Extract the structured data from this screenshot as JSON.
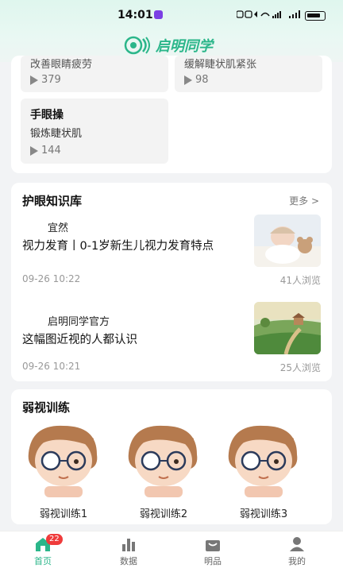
{
  "status": {
    "time": "14:01"
  },
  "brand": {
    "name": "启明同学",
    "color": "#2bb68a"
  },
  "top_tiles": [
    {
      "title": "",
      "subtitle": "改善眼睛疲劳",
      "plays": "379"
    },
    {
      "title": "",
      "subtitle": "缓解睫状肌紧张",
      "plays": "98"
    },
    {
      "title": "手眼操",
      "subtitle": "锻炼睫状肌",
      "plays": "144"
    }
  ],
  "knowledge": {
    "title": "护眼知识库",
    "more": "更多 >",
    "articles": [
      {
        "author": "宜然",
        "title": "视力发育丨0-1岁新生儿视力发育特点",
        "date": "09-26 10:22",
        "views": "41人浏览"
      },
      {
        "author": "启明同学官方",
        "title": "这幅图近视的人都认识",
        "date": "09-26 10:21",
        "views": "25人浏览"
      }
    ]
  },
  "training": {
    "title": "弱视训练",
    "items": [
      {
        "label": "弱视训练1"
      },
      {
        "label": "弱视训练2"
      },
      {
        "label": "弱视训练3"
      }
    ]
  },
  "tabbar": {
    "badge": "22",
    "items": [
      {
        "label": "首页",
        "icon": "home-icon",
        "active": true
      },
      {
        "label": "数据",
        "icon": "bar-chart-icon"
      },
      {
        "label": "明品",
        "icon": "bag-icon"
      },
      {
        "label": "我的",
        "icon": "user-icon"
      }
    ]
  }
}
